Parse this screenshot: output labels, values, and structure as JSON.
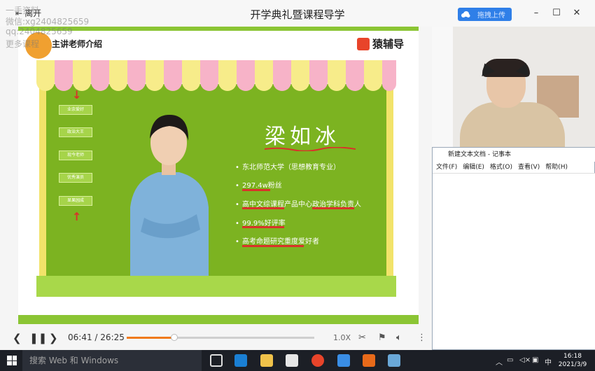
{
  "window": {
    "title": "开学典礼暨课程导学",
    "leave_label": "离开",
    "upload_label": "拖拽上传",
    "controls": [
      "minimize-icon",
      "maximize-icon",
      "close-icon"
    ]
  },
  "watermark": {
    "line1": "一手资料",
    "line2": "微信:xg2404825659",
    "line3": "qq:2404825659",
    "line4": "更多课程"
  },
  "slide": {
    "host_title": "主讲老师介绍",
    "brand": "猿辅导",
    "side_menu": [
      "业余爱好",
      "政治大王",
      "现今老师",
      "优秀演员",
      "显果园成"
    ],
    "teacher_name": "梁如冰",
    "bullets": [
      "东北师范大学（思想教育专业）",
      "297.4w粉丝",
      "高中文综课程产品中心政治学科负责人",
      "99.9%好评率",
      "高考命题研究重度爱好者"
    ],
    "colors": {
      "board": "#7cb321",
      "awning_pink": "#f7b3c8",
      "awning_yellow": "#f7ec8a",
      "accent_red": "#d9332a"
    }
  },
  "player": {
    "current_time": "06:41",
    "separator": "/",
    "total_time": "26:25",
    "progress": 0.253,
    "speed": "1.0X",
    "icons": [
      "prev-icon",
      "pause-icon",
      "next-icon",
      "scissors-icon",
      "flag-icon",
      "volume-icon",
      "more-icon"
    ]
  },
  "notepad": {
    "title": "新建文本文档 - 记事本",
    "menu": [
      "文件(F)",
      "编辑(E)",
      "格式(O)",
      "查看(V)",
      "帮助(H)"
    ]
  },
  "taskbar": {
    "search_placeholder": "搜索 Web 和 Windows",
    "tray_ime": "中",
    "time": "16:18",
    "date": "2021/3/9"
  }
}
